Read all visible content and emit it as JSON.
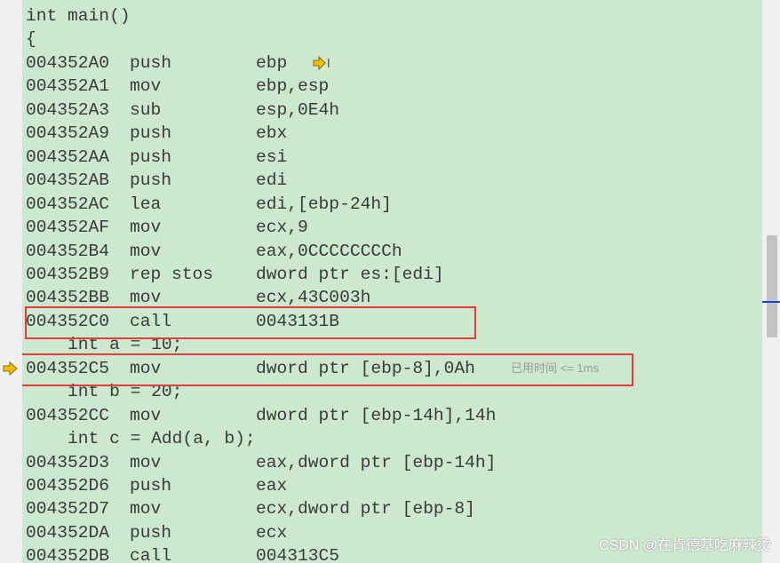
{
  "lines": [
    {
      "kind": "src",
      "text": "int main()"
    },
    {
      "kind": "src",
      "text": "{"
    },
    {
      "kind": "asm",
      "addr": "004352A0",
      "mn": "push",
      "op": "ebp"
    },
    {
      "kind": "asm",
      "addr": "004352A1",
      "mn": "mov",
      "op": "ebp,esp"
    },
    {
      "kind": "asm",
      "addr": "004352A3",
      "mn": "sub",
      "op": "esp,0E4h"
    },
    {
      "kind": "asm",
      "addr": "004352A9",
      "mn": "push",
      "op": "ebx"
    },
    {
      "kind": "asm",
      "addr": "004352AA",
      "mn": "push",
      "op": "esi"
    },
    {
      "kind": "asm",
      "addr": "004352AB",
      "mn": "push",
      "op": "edi"
    },
    {
      "kind": "asm",
      "addr": "004352AC",
      "mn": "lea",
      "op": "edi,[ebp-24h]"
    },
    {
      "kind": "asm",
      "addr": "004352AF",
      "mn": "mov",
      "op": "ecx,9"
    },
    {
      "kind": "asm",
      "addr": "004352B4",
      "mn": "mov",
      "op": "eax,0CCCCCCCCh"
    },
    {
      "kind": "asm",
      "addr": "004352B9",
      "mn": "rep stos",
      "op": "dword ptr es:[edi]"
    },
    {
      "kind": "asm",
      "addr": "004352BB",
      "mn": "mov",
      "op": "ecx,43C003h"
    },
    {
      "kind": "asm",
      "addr": "004352C0",
      "mn": "call",
      "op": "0043131B"
    },
    {
      "kind": "src",
      "text": "    int a = 10;"
    },
    {
      "kind": "asm",
      "addr": "004352C5",
      "mn": "mov",
      "op": "dword ptr [ebp-8],0Ah",
      "hint": "已用时间 <= 1ms"
    },
    {
      "kind": "src",
      "text": "    int b = 20;"
    },
    {
      "kind": "asm",
      "addr": "004352CC",
      "mn": "mov",
      "op": "dword ptr [ebp-14h],14h"
    },
    {
      "kind": "src",
      "text": "    int c = Add(a, b);"
    },
    {
      "kind": "asm",
      "addr": "004352D3",
      "mn": "mov",
      "op": "eax,dword ptr [ebp-14h]"
    },
    {
      "kind": "asm",
      "addr": "004352D6",
      "mn": "push",
      "op": "eax"
    },
    {
      "kind": "asm",
      "addr": "004352D7",
      "mn": "mov",
      "op": "ecx,dword ptr [ebp-8]"
    },
    {
      "kind": "asm",
      "addr": "004352DA",
      "mn": "push",
      "op": "ecx"
    },
    {
      "kind": "asm",
      "addr": "004352DB",
      "mn": "call",
      "op": "004313C5"
    }
  ],
  "watermark": "CSDN @在肯德基吃麻辣烫",
  "colors": {
    "background": "#cce8cf",
    "highlight_box": "#e83a3a",
    "ip_arrow": "#f2c200"
  },
  "icons": {
    "instruction_pointer": "yellow-arrow-icon",
    "run_to_cursor": "run-to-cursor-icon"
  }
}
